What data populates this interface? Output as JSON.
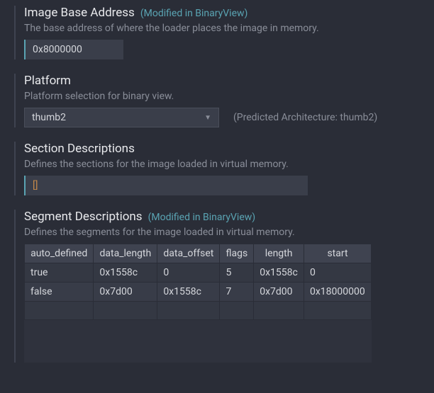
{
  "image_base": {
    "title": "Image Base Address",
    "modified": "(Modified in BinaryView)",
    "desc": "The base address of where the loader places the image in memory.",
    "value": "0x8000000"
  },
  "platform": {
    "title": "Platform",
    "desc": "Platform selection for binary view.",
    "value": "thumb2",
    "predicted": "(Predicted Architecture: thumb2)"
  },
  "sections": {
    "title": "Section Descriptions",
    "desc": "Defines the sections for the image loaded in virtual memory.",
    "open": "[",
    "close": "]"
  },
  "segments": {
    "title": "Segment Descriptions",
    "modified": "(Modified in BinaryView)",
    "desc": "Defines the segments for the image loaded in virtual memory.",
    "headers": {
      "auto_defined": "auto_defined",
      "data_length": "data_length",
      "data_offset": "data_offset",
      "flags": "flags",
      "length": "length",
      "start": "start"
    },
    "rows": [
      {
        "auto_defined": "true",
        "data_length": "0x1558c",
        "data_offset": "0",
        "flags": "5",
        "length": "0x1558c",
        "start": "0"
      },
      {
        "auto_defined": "false",
        "data_length": "0x7d00",
        "data_offset": "0x1558c",
        "flags": "7",
        "length": "0x7d00",
        "start": "0x18000000"
      }
    ]
  }
}
